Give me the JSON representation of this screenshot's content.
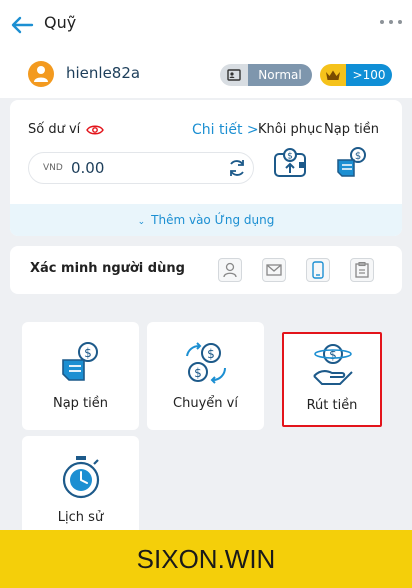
{
  "header": {
    "title": "Quỹ",
    "back_icon": "arrow-left-icon",
    "menu_icon": "more-dots-icon"
  },
  "user": {
    "name": "hienle82a",
    "avatar_color": "#f39a1f",
    "tier_label": "Normal",
    "level_label": ">100"
  },
  "wallet": {
    "balance_label": "Số dư ví",
    "details_link": "Chi tiết >",
    "restore_label": "Khôi phục",
    "deposit_label": "Nạp tiền",
    "currency": "VND",
    "amount": "0.00",
    "add_to_app": "Thêm vào Ứng dụng"
  },
  "verification": {
    "label": "Xác minh người dùng",
    "icons": [
      "person-icon",
      "mail-icon",
      "phone-icon",
      "id-card-icon"
    ]
  },
  "actions": [
    {
      "label": "Nạp tiền",
      "icon": "deposit-icon"
    },
    {
      "label": "Chuyển ví",
      "icon": "transfer-icon"
    },
    {
      "label": "Rút tiền",
      "icon": "withdraw-icon"
    },
    {
      "label": "Lịch sử",
      "icon": "stopwatch-icon"
    }
  ],
  "footer": {
    "text": "SIXON.WIN"
  },
  "colors": {
    "accent": "#1c8fd2",
    "highlight": "#e3141b",
    "footer_bg": "#f4cf0a"
  }
}
